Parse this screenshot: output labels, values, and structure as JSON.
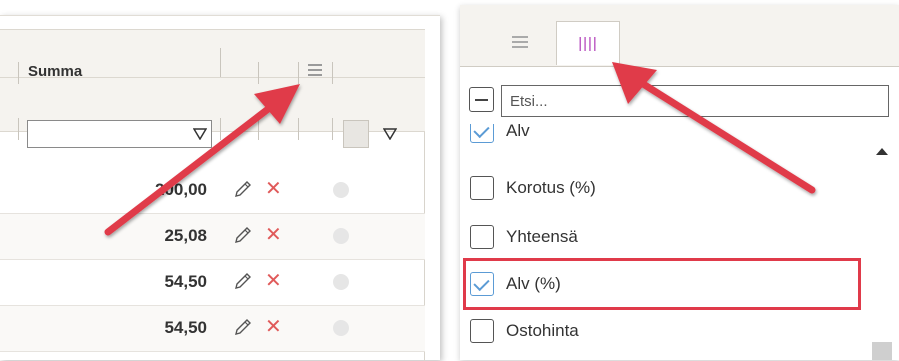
{
  "grid": {
    "column_title": "Summa",
    "rows": [
      {
        "summa": "200,00"
      },
      {
        "summa": "25,08"
      },
      {
        "summa": "54,50"
      },
      {
        "summa": "54,50"
      }
    ]
  },
  "column_chooser": {
    "search_placeholder": "Etsi...",
    "items": [
      {
        "label": "Alv",
        "checked": true
      },
      {
        "label": "Korotus (%)",
        "checked": false
      },
      {
        "label": "Yhteensä",
        "checked": false
      },
      {
        "label": "Alv (%)",
        "checked": true,
        "highlighted": true
      },
      {
        "label": "Ostohinta",
        "checked": false
      }
    ]
  },
  "icons": {
    "column_menu": "hamburger-icon",
    "filter": "filter-funnel-icon",
    "edit": "pencil-icon",
    "delete": "close-x-icon",
    "status": "status-dot-icon",
    "columns_tab": "columns-icon"
  },
  "colors": {
    "annotation_red": "#e03a4a",
    "delete_red": "#e05a5a",
    "checkbox_blue": "#5b9bd5",
    "columns_tab_purple": "#b03cb8",
    "header_bg": "#f5f3ef"
  }
}
